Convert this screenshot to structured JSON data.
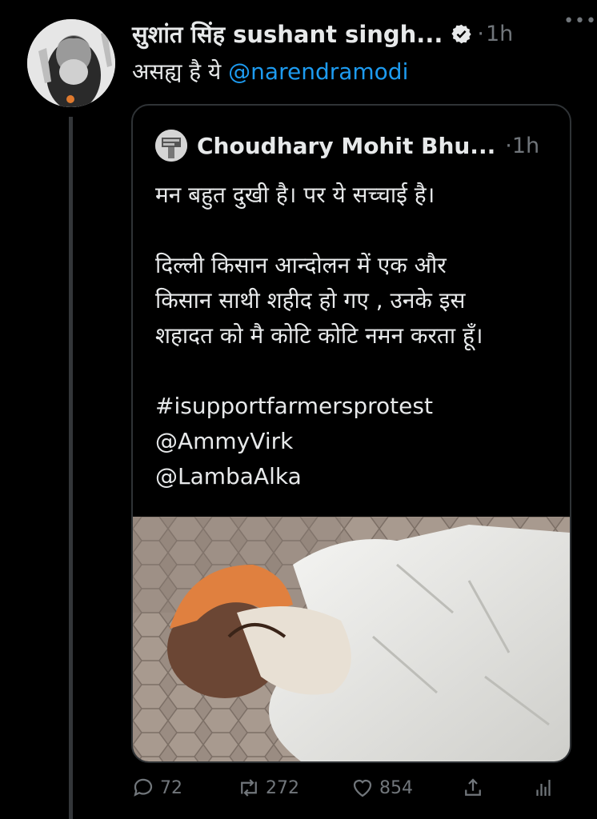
{
  "tweet": {
    "author_name": "सुशांत सिंह sushant singh...",
    "separator": "·",
    "time": "1h",
    "more_icon": "more-horizontal-icon",
    "text_prefix": "असह्य है ये ",
    "mention": "@narendramodi"
  },
  "quoted": {
    "author_name": "Choudhary Mohit Bhu...",
    "separator": "·",
    "time": "1h",
    "lines": [
      "मन बहुत दुखी है। पर ये सच्चाई है।",
      "",
      "दिल्ली किसान आन्दोलन में एक और",
      "किसान साथी शहीद हो गए , उनके इस",
      "शहादत को मै कोटि कोटि नमन करता हूँ।",
      "",
      "#isupportfarmersprotest",
      "@AmmyVirk",
      "@LambaAlka"
    ]
  },
  "actions": {
    "reply_count": "72",
    "retweet_count": "272",
    "like_count": "854"
  },
  "colors": {
    "background": "#000000",
    "text": "#e7e9ea",
    "secondary": "#71767b",
    "link": "#1d9bf0",
    "border": "#2f3336"
  }
}
